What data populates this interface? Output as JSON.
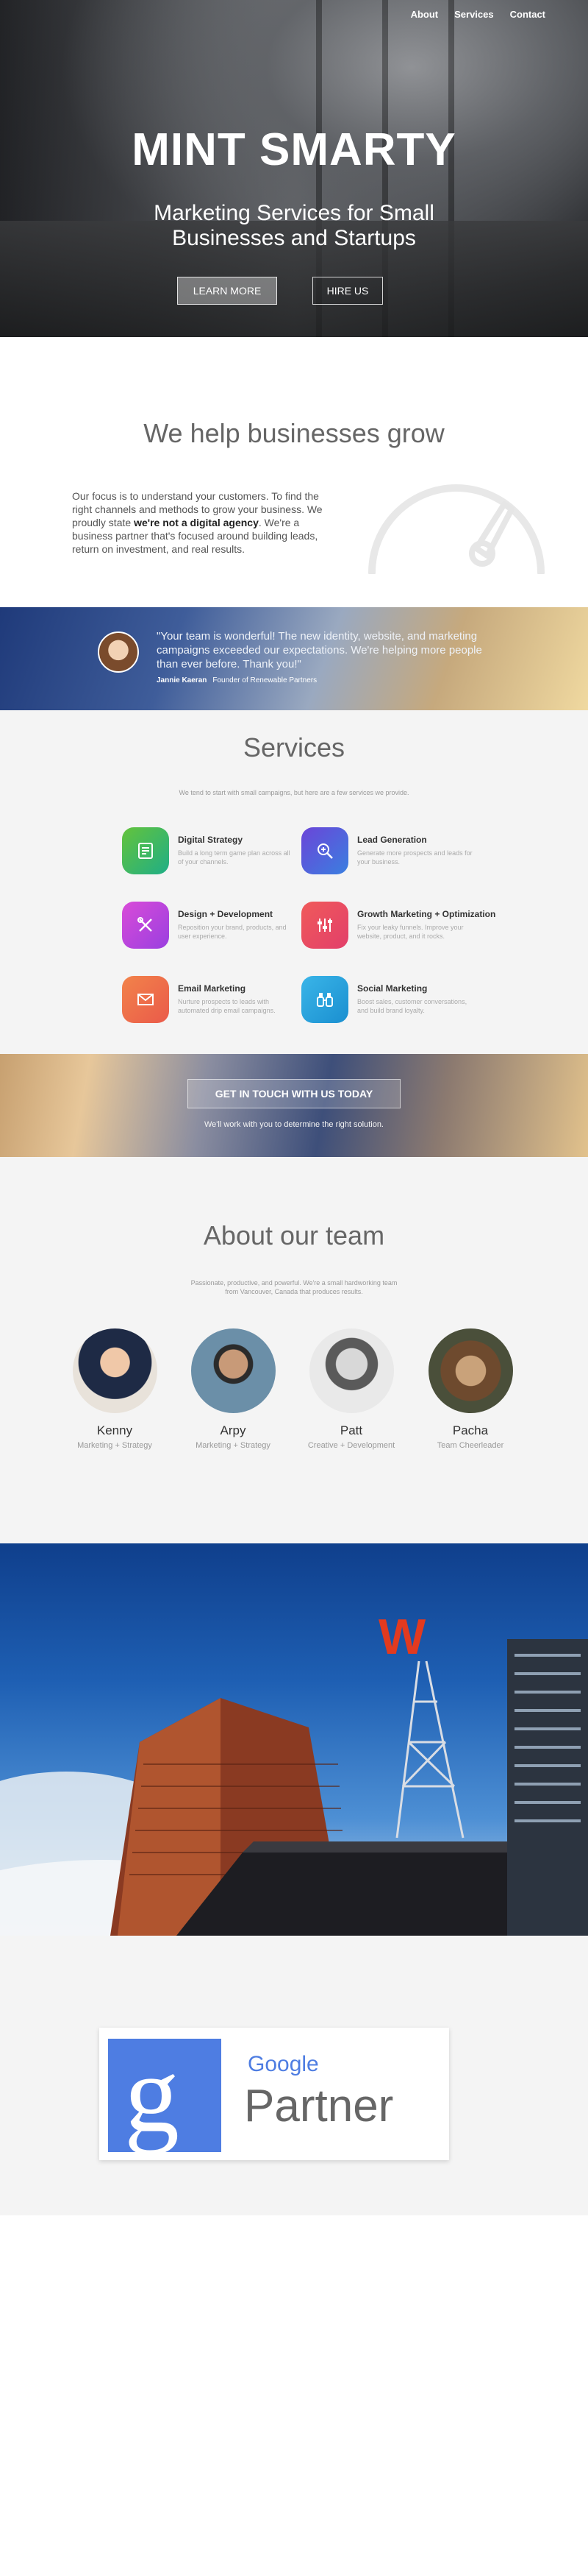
{
  "nav": {
    "about": "About",
    "services": "Services",
    "contact": "Contact"
  },
  "hero": {
    "title": "MINT SMARTY",
    "subtitle_line1": "Marketing Services for Small",
    "subtitle_line2": "Businesses and Startups",
    "learn_more": "LEARN MORE",
    "hire_us": "HIRE US"
  },
  "grow": {
    "title": "We help businesses grow",
    "text_part1": "Our focus is to understand your customers. To find the right channels and methods to grow your business. We proudly state ",
    "text_bold": "we're not a digital agency",
    "text_part2": ". We're a business partner that's focused around building leads, return on investment, and real results."
  },
  "testimonial": {
    "quote": "\"Your team is wonderful! The new identity, website, and marketing campaigns exceeded our expectations. We're helping more people than ever before. Thank you!\"",
    "author": "Jannie Kaeran",
    "role": "Founder of Renewable Partners"
  },
  "services": {
    "title": "Services",
    "intro": "We tend to start with small campaigns, but here are a few services we provide.",
    "items": [
      {
        "name": "Digital Strategy",
        "desc": "Build a long term game plan across all of your channels.",
        "color_from": "#64c33b",
        "color_to": "#1fae86",
        "icon": "document-icon"
      },
      {
        "name": "Lead Generation",
        "desc": "Generate more prospects and leads for your business.",
        "color_from": "#6b45d8",
        "color_to": "#3a7fe0",
        "icon": "magnifier-icon"
      },
      {
        "name": "Design + Development",
        "desc": "Reposition your brand, products, and user experience.",
        "color_from": "#d94bd8",
        "color_to": "#9a3fe0",
        "icon": "tools-icon"
      },
      {
        "name": "Growth Marketing + Optimization",
        "desc": "Fix your leaky funnels. Improve your website, product, and it rocks.",
        "color_from": "#f05a5a",
        "color_to": "#e23f6a",
        "icon": "sliders-icon"
      },
      {
        "name": "Email Marketing",
        "desc": "Nurture prospects to leads with automated drip email campaigns.",
        "color_from": "#f2834a",
        "color_to": "#ea5a4a",
        "icon": "envelope-icon"
      },
      {
        "name": "Social Marketing",
        "desc": "Boost sales, customer conversations, and build brand loyalty.",
        "color_from": "#3ab5e8",
        "color_to": "#1a8fd0",
        "icon": "binoculars-icon"
      }
    ]
  },
  "cta": {
    "button": "GET IN TOUCH WITH US TODAY",
    "sub": "We'll work with you to determine the right solution."
  },
  "team": {
    "title": "About our team",
    "intro_line1": "Passionate, productive, and powerful. We're a small hardworking team",
    "intro_line2": "from Vancouver, Canada that produces results.",
    "members": [
      {
        "name": "Kenny",
        "role": "Marketing + Strategy"
      },
      {
        "name": "Arpy",
        "role": "Marketing + Strategy"
      },
      {
        "name": "Patt",
        "role": "Creative + Development"
      },
      {
        "name": "Pacha",
        "role": "Team Cheerleader"
      }
    ]
  },
  "partner": {
    "google": "Google",
    "partner": "Partner"
  }
}
